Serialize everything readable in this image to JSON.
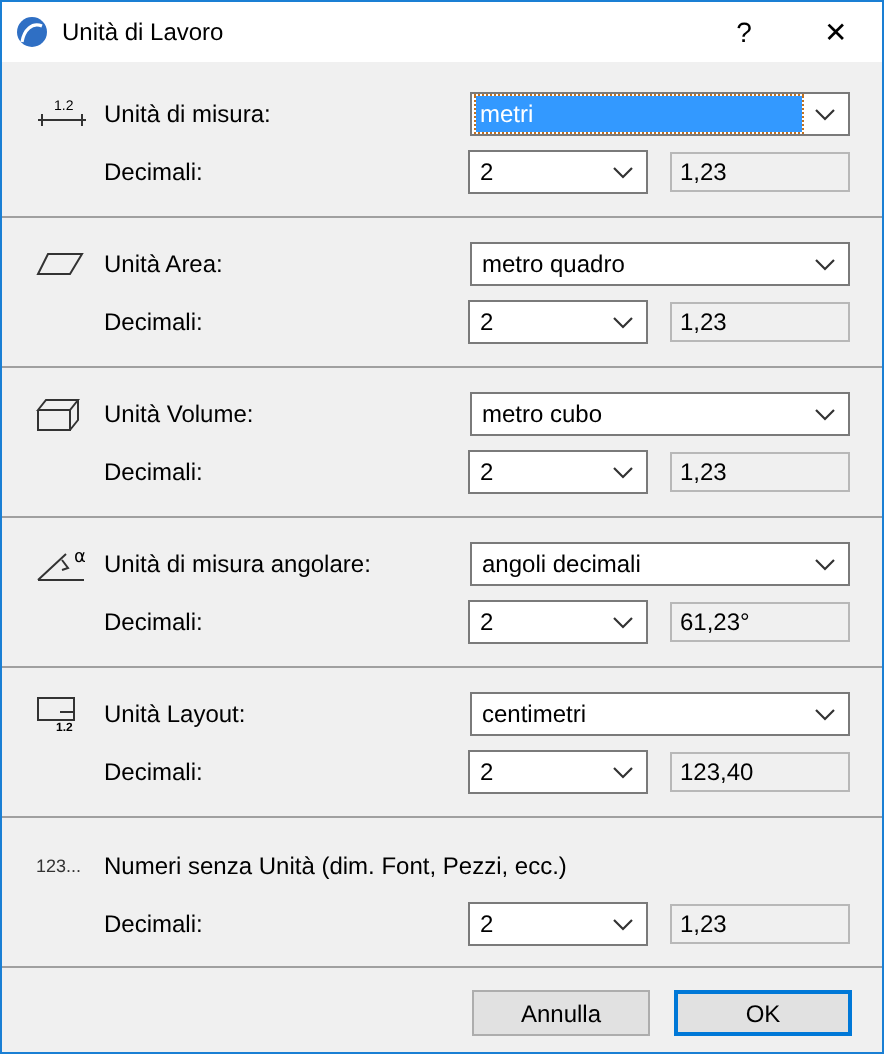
{
  "window": {
    "title": "Unità di Lavoro",
    "help": "?",
    "close": "✕"
  },
  "sections": [
    {
      "kind": "length",
      "icon_text": "1.2",
      "label": "Unità di misura:",
      "unit": {
        "value": "metri",
        "focused": true
      },
      "decimals_label": "Decimali:",
      "decimals": "2",
      "preview": "1,23"
    },
    {
      "kind": "area",
      "label": "Unità Area:",
      "unit": {
        "value": "metro quadro",
        "focused": false
      },
      "decimals_label": "Decimali:",
      "decimals": "2",
      "preview": "1,23"
    },
    {
      "kind": "volume",
      "label": "Unità Volume:",
      "unit": {
        "value": "metro cubo",
        "focused": false
      },
      "decimals_label": "Decimali:",
      "decimals": "2",
      "preview": "1,23"
    },
    {
      "kind": "angle",
      "icon_text": "α",
      "label": "Unità di misura angolare:",
      "unit": {
        "value": "angoli decimali",
        "focused": false
      },
      "decimals_label": "Decimali:",
      "decimals": "2",
      "preview": "61,23°"
    },
    {
      "kind": "layout",
      "icon_text": "1.2",
      "label": "Unità Layout:",
      "unit": {
        "value": "centimetri",
        "focused": false
      },
      "decimals_label": "Decimali:",
      "decimals": "2",
      "preview": "123,40"
    },
    {
      "kind": "number",
      "icon_text": "123...",
      "label": "Numeri senza Unità (dim. Font, Pezzi, ecc.)",
      "decimals_label": "Decimali:",
      "decimals": "2",
      "preview": "1,23"
    }
  ],
  "buttons": [
    {
      "label": "Annulla",
      "default": false
    },
    {
      "label": "OK",
      "default": true
    }
  ]
}
